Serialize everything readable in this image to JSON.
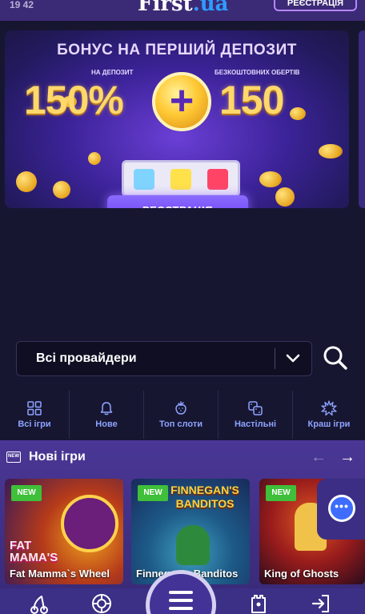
{
  "status": {
    "time": "19 42"
  },
  "header": {
    "logo_main": "First",
    "logo_accent": ".ua",
    "register_label": "РЕЄСТРАЦІЯ"
  },
  "banner": {
    "title": "БОНУС НА ПЕРШИЙ ДЕПОЗИТ",
    "caption_left": "НА ДЕПОЗИТ",
    "caption_right": "БЕЗКОШТОВНИХ ОБЕРТІВ",
    "value_left": "150%",
    "plus": "+",
    "value_right": "150",
    "button_label": "РЕЄСТРАЦІЯ"
  },
  "provider": {
    "label": "Всі провайдери"
  },
  "tabs": [
    {
      "label": "Всі ігри",
      "icon": "grid-icon"
    },
    {
      "label": "Нове",
      "icon": "bell-icon"
    },
    {
      "label": "Топ слоти",
      "icon": "strawberry-icon"
    },
    {
      "label": "Настільні",
      "icon": "dice-icon"
    },
    {
      "label": "Краш ігри",
      "icon": "explosion-icon"
    }
  ],
  "section": {
    "badge": "NEW",
    "title": "Нові ігри"
  },
  "games": [
    {
      "badge": "NEW",
      "name": "Fat Mamma`s Wheel",
      "art": "FAT MAMA'S"
    },
    {
      "badge": "NEW",
      "name": "Finnegan's Banditos",
      "art": "FINNEGAN'S BANDITOS"
    },
    {
      "badge": "NEW",
      "name": "King of Ghosts",
      "art": ""
    }
  ],
  "colors": {
    "accent": "#6a3cf0",
    "tab_text": "#8da3ff",
    "new_badge": "#3fbf3a",
    "bg": "#171631"
  }
}
